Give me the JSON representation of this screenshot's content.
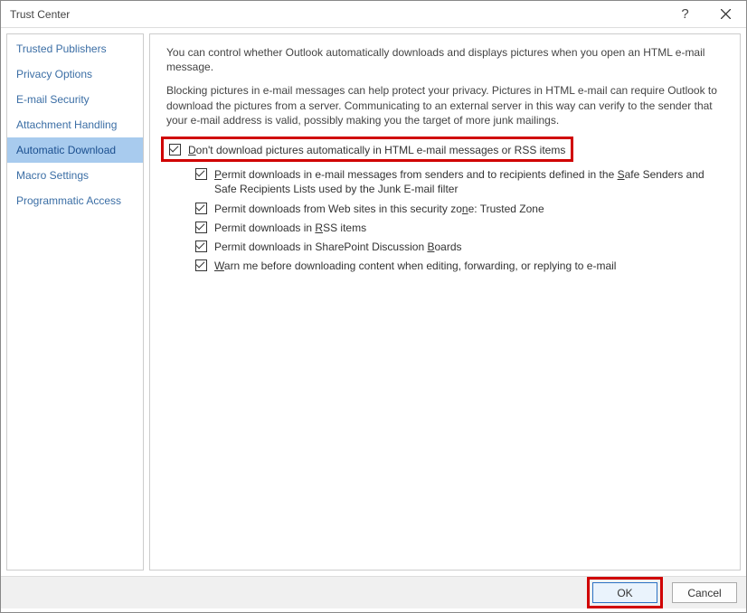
{
  "window": {
    "title": "Trust Center"
  },
  "sidebar": {
    "items": [
      {
        "label": "Trusted Publishers"
      },
      {
        "label": "Privacy Options"
      },
      {
        "label": "E-mail Security"
      },
      {
        "label": "Attachment Handling"
      },
      {
        "label": "Automatic Download"
      },
      {
        "label": "Macro Settings"
      },
      {
        "label": "Programmatic Access"
      }
    ],
    "selected_index": 4
  },
  "content": {
    "para1": "You can control whether Outlook automatically downloads and displays pictures when you open an HTML e-mail message.",
    "para2": "Blocking pictures in e-mail messages can help protect your privacy. Pictures in HTML e-mail can require Outlook to download the pictures from a server. Communicating to an external server in this way can verify to the sender that your e-mail address is valid, possibly making you the target of more junk mailings.",
    "opt_main": {
      "pre": "",
      "mn": "D",
      "post": "on't download pictures automatically in HTML e-mail messages or RSS items",
      "checked": true
    },
    "subs": [
      {
        "mn": "P",
        "post": "ermit downloads in e-mail messages from senders and to recipients defined in the ",
        "mn2": "S",
        "post2": "afe Senders and Safe Recipients Lists used by the Junk E-mail filter",
        "checked": true
      },
      {
        "pre": "Permit downloads from Web sites in this security zo",
        "mn": "n",
        "post": "e: Trusted Zone",
        "checked": true
      },
      {
        "pre": "Permit downloads in ",
        "mn": "R",
        "post": "SS items",
        "checked": true
      },
      {
        "pre": "Permit downloads in SharePoint Discussion ",
        "mn": "B",
        "post": "oards",
        "checked": true
      },
      {
        "mn": "W",
        "post": "arn me before downloading content when editing, forwarding, or replying to e-mail",
        "checked": true
      }
    ]
  },
  "footer": {
    "ok": "OK",
    "cancel": "Cancel"
  }
}
